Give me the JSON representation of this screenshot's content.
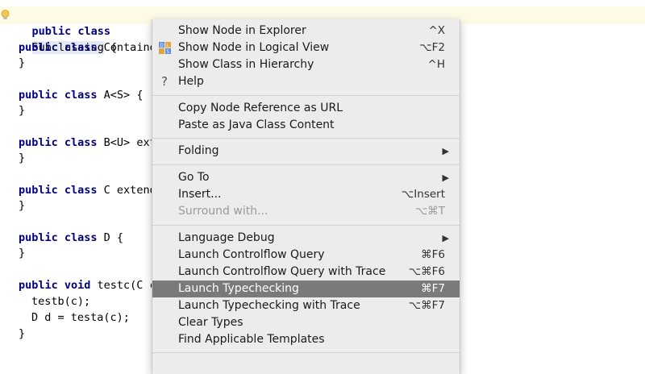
{
  "editor": {
    "lines": [
      {
        "kw": "public class",
        "name": "Subclassing",
        "rest": " {"
      },
      {
        "kw": "public class",
        "rest": " Containe"
      },
      {
        "rest": "}"
      },
      {
        "kw": "public class",
        "rest": " A<S> {"
      },
      {
        "rest": "}"
      },
      {
        "kw": "public class",
        "rest": " B<U> ext"
      },
      {
        "rest": "}"
      },
      {
        "kw": "public class",
        "rest": " C extend"
      },
      {
        "rest": "}"
      },
      {
        "kw": "public class",
        "rest": " D {"
      },
      {
        "rest": "}"
      },
      {
        "kw": "public void",
        "rest": " testc(C c"
      },
      {
        "rest": "testb(c);"
      },
      {
        "rest": "D d = testa(c);"
      },
      {
        "rest": "}"
      }
    ]
  },
  "menu": {
    "items": [
      {
        "label": "Show Node in Explorer",
        "shortcut": "^X"
      },
      {
        "label": "Show Node in Logical View",
        "shortcut": "⌥F2",
        "icon": "dls-logical-view-icon"
      },
      {
        "label": "Show Class in Hierarchy",
        "shortcut": "^H"
      },
      {
        "label": "Help",
        "icon": "help-icon"
      },
      {
        "label": "Copy Node Reference as URL"
      },
      {
        "label": "Paste as Java Class Content"
      },
      {
        "label": "Folding",
        "submenu": true
      },
      {
        "label": "Go To",
        "submenu": true
      },
      {
        "label": "Insert...",
        "shortcut": "⌥Insert"
      },
      {
        "label": "Surround with...",
        "shortcut": "⌥⌘T",
        "disabled": true
      },
      {
        "label": "Language Debug",
        "submenu": true
      },
      {
        "label": "Launch Controlflow Query",
        "shortcut": "⌘F6"
      },
      {
        "label": "Launch Controlflow Query with Trace",
        "shortcut": "⌥⌘F6"
      },
      {
        "label": "Launch Typechecking",
        "shortcut": "⌘F7",
        "selected": true
      },
      {
        "label": "Launch Typechecking with Trace",
        "shortcut": "⌥⌘F7"
      },
      {
        "label": "Clear Types"
      },
      {
        "label": "Find Applicable Templates"
      }
    ],
    "submenu_arrow": "▶",
    "help_glyph": "?",
    "dls_icon_letters": [
      "D",
      "L",
      "S"
    ]
  },
  "colors": {
    "keyword": "#000080",
    "selection": "#7a7a7a",
    "menu_bg": "#ececec"
  }
}
